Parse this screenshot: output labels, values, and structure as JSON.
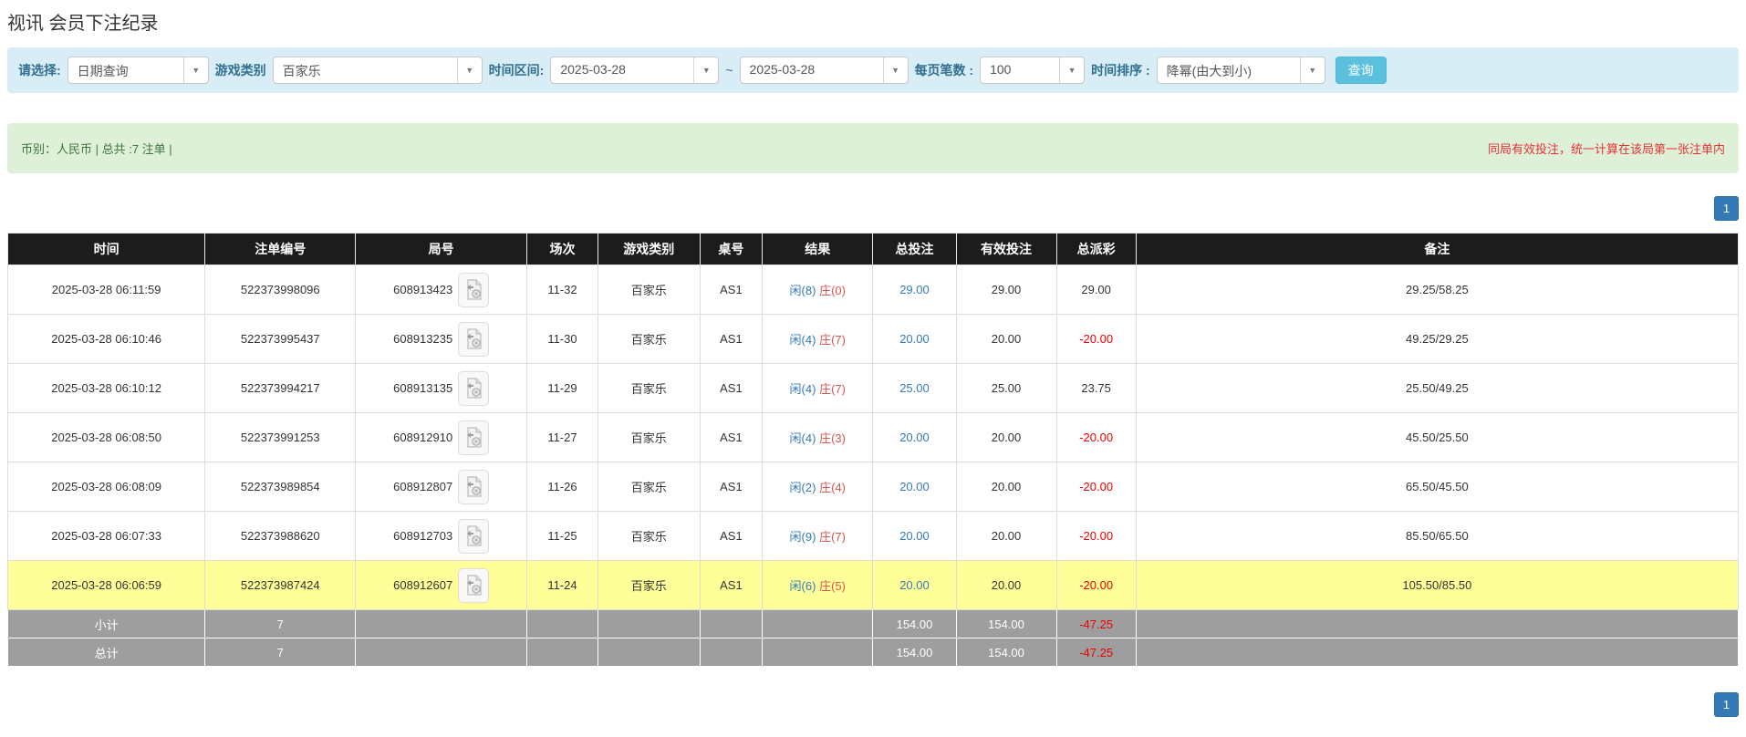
{
  "page": {
    "title": "视讯 会员下注纪录"
  },
  "filter_bar": {
    "query_type": {
      "label": "请选择:",
      "value": "日期查询"
    },
    "game_category": {
      "label": "游戏类别",
      "value": "百家乐"
    },
    "time_range": {
      "label": "时间区间:",
      "from": "2025-03-28",
      "separator": "~",
      "to": "2025-03-28"
    },
    "page_size": {
      "label": "每页笔数 :",
      "value": "100"
    },
    "time_sort": {
      "label": "时间排序 :",
      "value": "降幂(由大到小)"
    },
    "search_button": "查询"
  },
  "summary_bar": {
    "left": "币别：人民币 | 总共 :7 注单 |",
    "right": "同局有效投注，统一计算在该局第一张注单内"
  },
  "pagination": {
    "page": "1"
  },
  "colors": {
    "accent_blue": "#337ab7",
    "search_button": "#5bc0de",
    "filter_bg": "#d9edf7",
    "summary_bg": "#dff0d8",
    "header_bg": "#1c1c1c",
    "highlight_row": "#ffff99",
    "total_row_bg": "#9e9e9e",
    "negative_red": "#ee0000",
    "player_blue": "#337ab7",
    "banker_red": "#d9534f"
  },
  "icons": {
    "video_replay": "video-replay-icon",
    "chevron_down": "chevron-down-icon"
  },
  "table": {
    "headers": [
      "时间",
      "注单编号",
      "局号",
      "场次",
      "游戏类别",
      "桌号",
      "结果",
      "总投注",
      "有效投注",
      "总派彩",
      "备注"
    ],
    "rows": [
      {
        "time": "2025-03-28 06:11:59",
        "bet_id": "522373998096",
        "round": "608913423",
        "session": "11-32",
        "game": "百家乐",
        "table_no": "AS1",
        "result_player": "闲(8)",
        "result_banker": "庄(0)",
        "total_bet": "29.00",
        "valid_bet": "29.00",
        "payout": "29.00",
        "remark": "29.25/58.25",
        "highlight": false
      },
      {
        "time": "2025-03-28 06:10:46",
        "bet_id": "522373995437",
        "round": "608913235",
        "session": "11-30",
        "game": "百家乐",
        "table_no": "AS1",
        "result_player": "闲(4)",
        "result_banker": "庄(7)",
        "total_bet": "20.00",
        "valid_bet": "20.00",
        "payout": "-20.00",
        "remark": "49.25/29.25",
        "highlight": false
      },
      {
        "time": "2025-03-28 06:10:12",
        "bet_id": "522373994217",
        "round": "608913135",
        "session": "11-29",
        "game": "百家乐",
        "table_no": "AS1",
        "result_player": "闲(4)",
        "result_banker": "庄(7)",
        "total_bet": "25.00",
        "valid_bet": "25.00",
        "payout": "23.75",
        "remark": "25.50/49.25",
        "highlight": false
      },
      {
        "time": "2025-03-28 06:08:50",
        "bet_id": "522373991253",
        "round": "608912910",
        "session": "11-27",
        "game": "百家乐",
        "table_no": "AS1",
        "result_player": "闲(4)",
        "result_banker": "庄(3)",
        "total_bet": "20.00",
        "valid_bet": "20.00",
        "payout": "-20.00",
        "remark": "45.50/25.50",
        "highlight": false
      },
      {
        "time": "2025-03-28 06:08:09",
        "bet_id": "522373989854",
        "round": "608912807",
        "session": "11-26",
        "game": "百家乐",
        "table_no": "AS1",
        "result_player": "闲(2)",
        "result_banker": "庄(4)",
        "total_bet": "20.00",
        "valid_bet": "20.00",
        "payout": "-20.00",
        "remark": "65.50/45.50",
        "highlight": false
      },
      {
        "time": "2025-03-28 06:07:33",
        "bet_id": "522373988620",
        "round": "608912703",
        "session": "11-25",
        "game": "百家乐",
        "table_no": "AS1",
        "result_player": "闲(9)",
        "result_banker": "庄(7)",
        "total_bet": "20.00",
        "valid_bet": "20.00",
        "payout": "-20.00",
        "remark": "85.50/65.50",
        "highlight": false
      },
      {
        "time": "2025-03-28 06:06:59",
        "bet_id": "522373987424",
        "round": "608912607",
        "session": "11-24",
        "game": "百家乐",
        "table_no": "AS1",
        "result_player": "闲(6)",
        "result_banker": "庄(5)",
        "total_bet": "20.00",
        "valid_bet": "20.00",
        "payout": "-20.00",
        "remark": "105.50/85.50",
        "highlight": true
      }
    ],
    "footer_rows": [
      {
        "label": "小计",
        "count": "7",
        "total_bet": "154.00",
        "valid_bet": "154.00",
        "payout": "-47.25"
      },
      {
        "label": "总计",
        "count": "7",
        "total_bet": "154.00",
        "valid_bet": "154.00",
        "payout": "-47.25"
      }
    ]
  }
}
